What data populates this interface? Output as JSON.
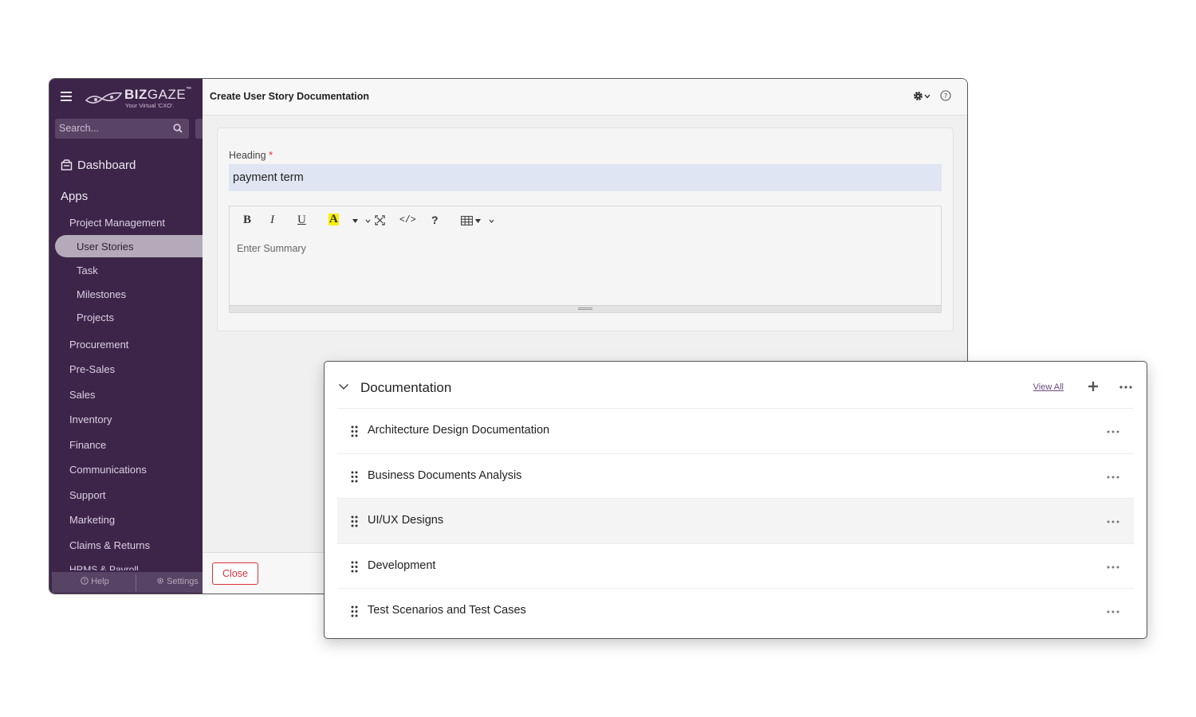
{
  "brand": {
    "name_bold": "BIZ",
    "name_light": "GAZE",
    "trademark": "™",
    "tagline": "Your Virtual 'CXO'."
  },
  "sidebar": {
    "search_placeholder": "Search...",
    "dashboard_label": "Dashboard",
    "apps_label": "Apps",
    "project_management": "Project Management",
    "project_subitems": [
      "User Stories",
      "Task",
      "Milestones",
      "Projects"
    ],
    "active_item": "User Stories",
    "modules": [
      "Procurement",
      "Pre-Sales",
      "Sales",
      "Inventory",
      "Finance",
      "Communications",
      "Support",
      "Marketing",
      "Claims & Returns"
    ],
    "cut_item": "HRMS & Payroll",
    "footer": {
      "help": "Help",
      "settings": "Settings"
    }
  },
  "main": {
    "title": "Create User Story Documentation",
    "heading_label": "Heading",
    "required_mark": "*",
    "heading_value": "payment term",
    "summary_placeholder": "Enter Summary",
    "toolbar": {
      "bold": "B",
      "italic": "I",
      "underline": "U",
      "highlight": "A",
      "code": "</>",
      "help": "?"
    },
    "close_label": "Close"
  },
  "documentation": {
    "title": "Documentation",
    "view_all": "View All",
    "items": [
      {
        "label": "Architecture Design Documentation",
        "highlighted": false
      },
      {
        "label": "Business Documents Analysis",
        "highlighted": false
      },
      {
        "label": "UI/UX Designs",
        "highlighted": true
      },
      {
        "label": "Development",
        "highlighted": false
      },
      {
        "label": "Test Scenarios and Test Cases",
        "highlighted": false
      }
    ]
  },
  "colors": {
    "sidebar_bg": "#3d2549",
    "active_pill": "#b5aab9",
    "required": "#d8323a",
    "heading_input_bg": "#dfe5f2",
    "link": "#6a4a80"
  },
  "icons": [
    "hamburger-icon",
    "logo-mark-icon",
    "search-icon",
    "dashboard-icon",
    "gear-icon",
    "chevron-down-icon",
    "help-circle-icon",
    "fullscreen-icon",
    "table-icon",
    "collapse-chevron-icon",
    "plus-icon",
    "more-horizontal-icon",
    "drag-handle-icon"
  ]
}
